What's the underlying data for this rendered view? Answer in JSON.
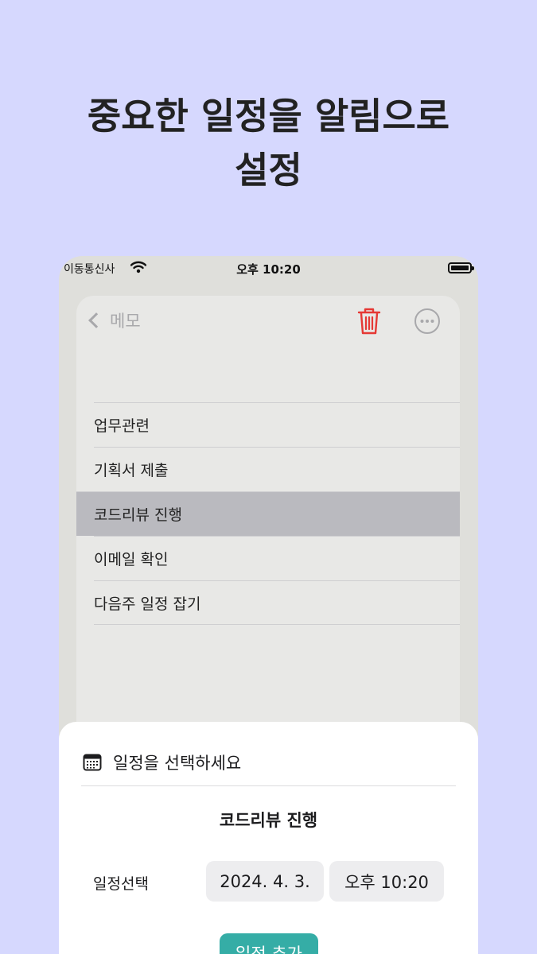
{
  "headline": {
    "line1": "중요한 일정을 알림으로",
    "line2": "설정"
  },
  "statusbar": {
    "carrier": "이동통신사",
    "time": "오후 10:20"
  },
  "nav": {
    "back_label": "메모"
  },
  "memo_lines": [
    {
      "text": "업무관련",
      "selected": false
    },
    {
      "text": "기획서 제출",
      "selected": false
    },
    {
      "text": "코드리뷰 진행",
      "selected": true
    },
    {
      "text": "이메일 확인",
      "selected": false
    },
    {
      "text": "다음주 일정 잡기",
      "selected": false
    }
  ],
  "sheet": {
    "title": "일정을 선택하세요",
    "selected_item": "코드리뷰 진행",
    "picker_label": "일정선택",
    "date_value": "2024. 4. 3.",
    "time_value": "오후 10:20",
    "add_button": "일정 추가"
  },
  "colors": {
    "background": "#d6d8fe",
    "accent": "#35ada6",
    "delete": "#e53935"
  }
}
